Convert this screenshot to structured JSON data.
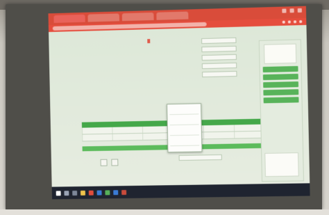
{
  "browser": {
    "tabs": [
      "",
      "",
      "",
      ""
    ],
    "address": ""
  },
  "page": {
    "left_title": "",
    "badge": "",
    "form_rows": [
      {
        "label": "",
        "value": ""
      },
      {
        "label": "",
        "value": ""
      },
      {
        "label": "",
        "value": ""
      },
      {
        "label": "",
        "value": ""
      },
      {
        "label": "",
        "value": ""
      }
    ],
    "table_rows": [
      [
        "",
        "",
        "",
        "",
        "",
        ""
      ],
      [
        "",
        "",
        "",
        "",
        "",
        ""
      ]
    ],
    "popup_items": [
      "",
      "",
      "",
      ""
    ],
    "buttons": [
      "",
      ""
    ]
  },
  "sidebar": {
    "logo_text": "",
    "buttons": [
      "",
      "",
      "",
      "",
      ""
    ],
    "note": ""
  },
  "taskbar": {
    "tray": ""
  },
  "colors": {
    "tab_bar": "#d94c3a",
    "accent_green": "#45a84a",
    "taskbar": "#1f2430"
  }
}
